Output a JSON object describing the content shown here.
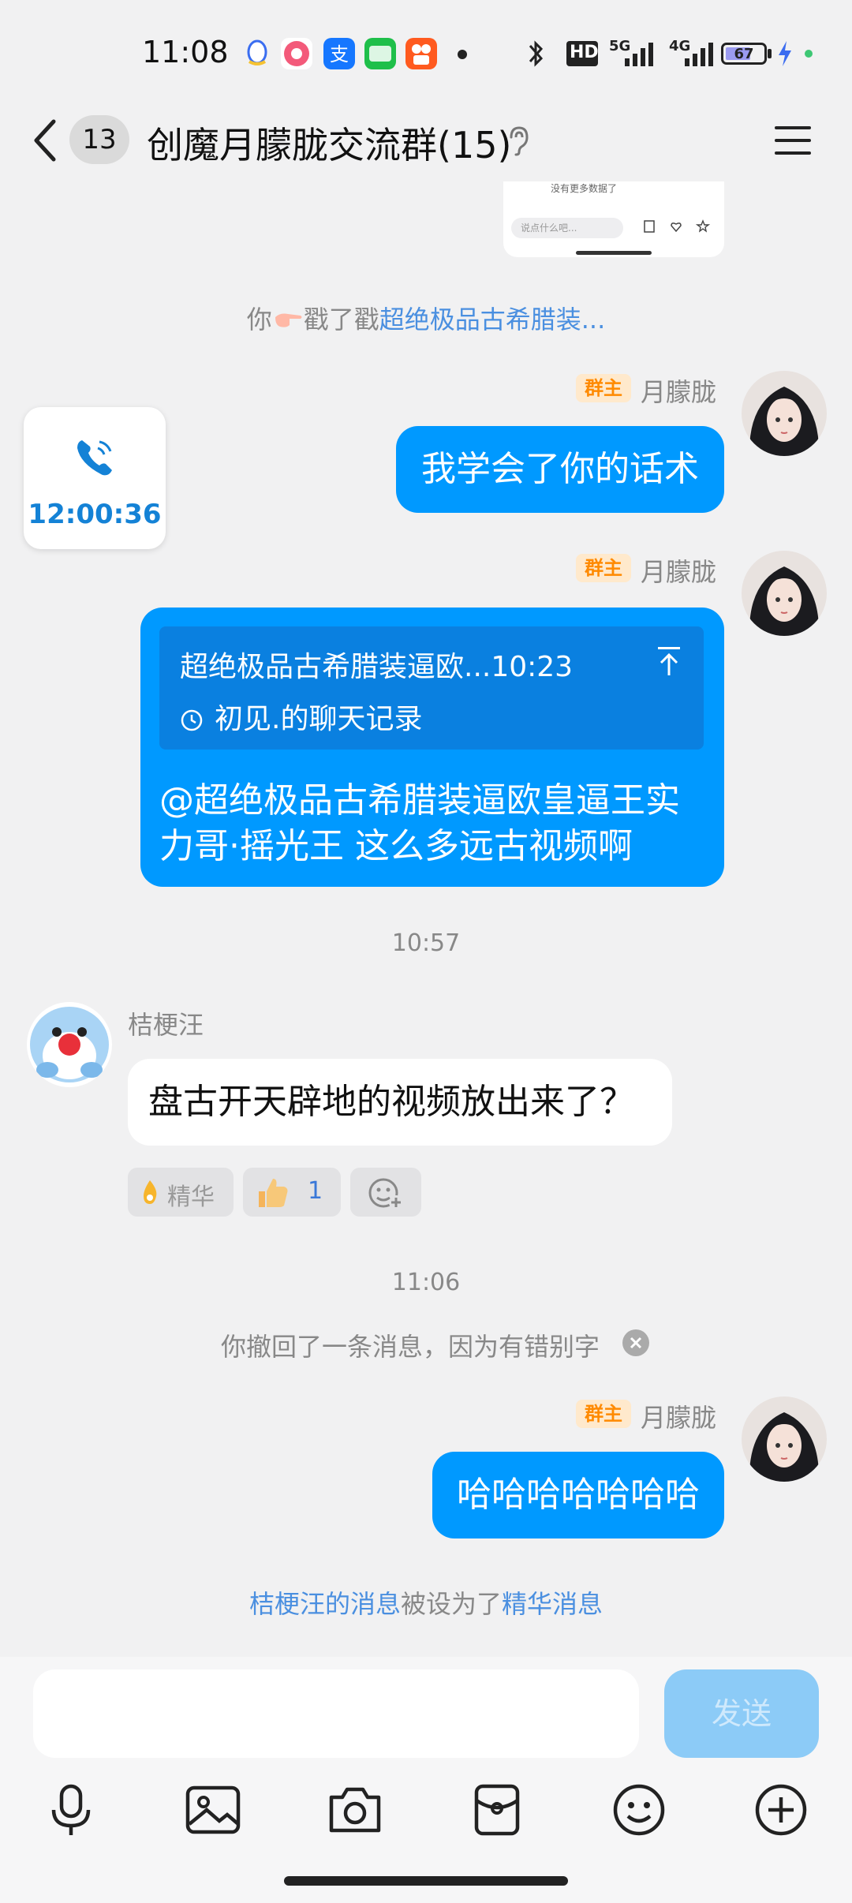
{
  "status_bar": {
    "time": "11:08",
    "network_label": "HD",
    "signal_5g": "5G",
    "signal_4g": "4G",
    "battery": "67",
    "battery_level": 0.67
  },
  "header": {
    "unread_count": "13",
    "title": "创魔月朦胧交流群(15)"
  },
  "preview": {
    "top_text": "没有更多数据了",
    "input_placeholder": "说点什么吧..."
  },
  "system_poke": {
    "prefix": "你",
    "middle": "戳了戳",
    "target": "超绝极品古希腊装..."
  },
  "call_card": {
    "time": "12:00:36"
  },
  "messages": {
    "m1": {
      "badge": "群主",
      "sender": "月朦胧",
      "text": "我学会了你的话术"
    },
    "m2": {
      "badge": "群主",
      "sender": "月朦胧",
      "reply_header": "超绝极品古希腊装逼欧...10:23",
      "reply_sub": "初见.的聊天记录",
      "text": "@超绝极品古希腊装逼欧皇逼王实力哥·摇光王 这么多远古视频啊"
    },
    "time1": "10:57",
    "m3": {
      "sender": "桔梗汪",
      "text": "盘古开天辟地的视频放出来了？",
      "react_essence": "精华",
      "react_like_count": "1"
    },
    "time2": "11:06",
    "recall": "你撤回了一条消息，因为有错别字",
    "m4": {
      "badge": "群主",
      "sender": "月朦胧",
      "text": "哈哈哈哈哈哈哈"
    },
    "essence_notice": {
      "part1": "桔梗汪的消息",
      "part2": "被设为了",
      "part3": "精华消息"
    }
  },
  "input_bar": {
    "placeholder": "",
    "send_label": "发送"
  },
  "colors": {
    "accent": "#0099ff",
    "link": "#4a8fe0",
    "badge_bg": "#ffe9cc",
    "badge_text": "#ff8a00",
    "send_disabled": "#8ccbf7"
  }
}
